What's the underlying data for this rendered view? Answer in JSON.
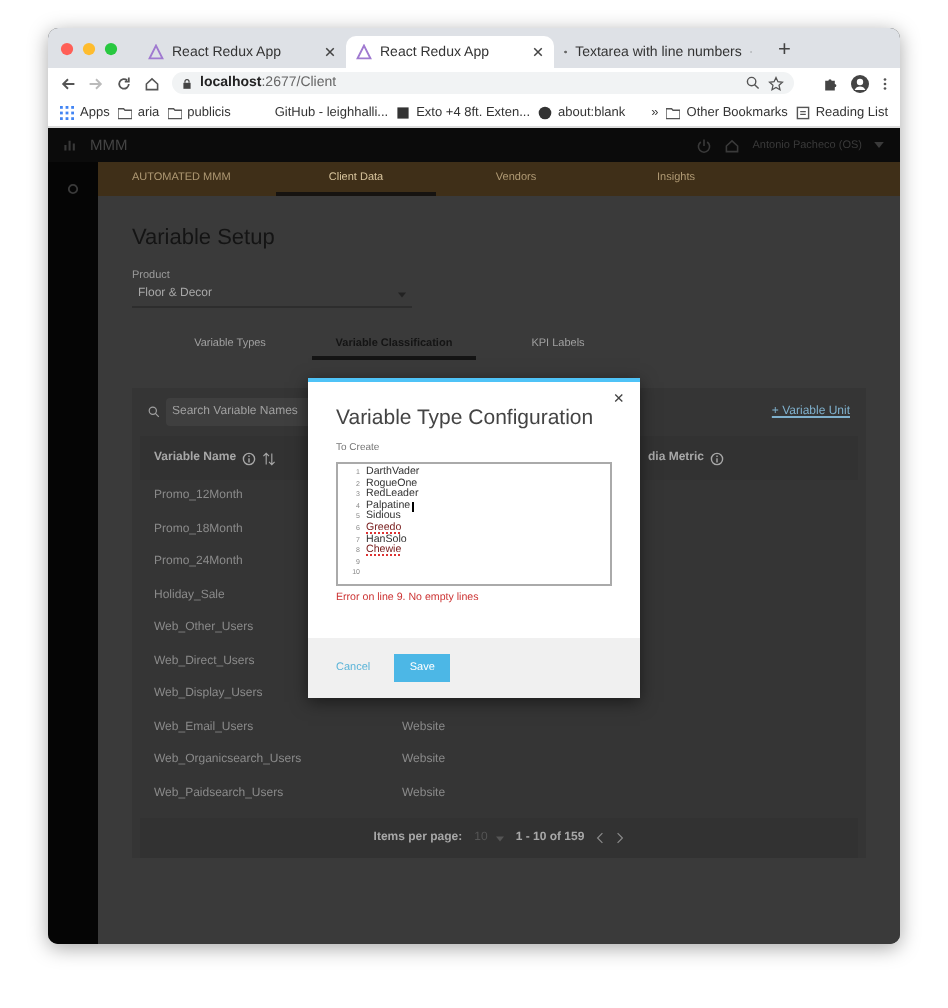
{
  "browser": {
    "tabs": [
      {
        "title": "React Redux App",
        "selected": false
      },
      {
        "title": "React Redux App",
        "selected": true
      },
      {
        "title": "Textarea with line numbers",
        "selected": false
      }
    ],
    "new_tab": "+",
    "url_host": "localhost",
    "url_path": ":2677/Client",
    "bookmarks": [
      "Apps",
      "aria",
      "publicis",
      "GitHub - leighhalli...",
      "Exto +4 8ft. Exten...",
      "about:blank"
    ],
    "more": "»",
    "other_bookmarks": "Other Bookmarks",
    "reading_list": "Reading List"
  },
  "app": {
    "logo": "MMM",
    "user": "Antonio Pacheco (OS)",
    "nav": [
      {
        "label": "AUTOMATED MMM",
        "selected": false
      },
      {
        "label": "Client Data",
        "selected": true
      },
      {
        "label": "Vendors",
        "selected": false
      },
      {
        "label": "Insights",
        "selected": false
      }
    ],
    "title": "Variable Setup",
    "product_label": "Product",
    "product_value": "Floor & Decor",
    "tabs": [
      {
        "label": "Variable Types",
        "selected": false
      },
      {
        "label": "Variable Classification",
        "selected": true
      },
      {
        "label": "KPI Labels",
        "selected": false
      }
    ],
    "search": {
      "placeholder": "Search Variable Names"
    },
    "add_link": "+ Variable Unit",
    "columns": [
      "Variable Name",
      "dia Metric"
    ],
    "rows": [
      {
        "name": "Promo_12Month"
      },
      {
        "name": "Promo_18Month"
      },
      {
        "name": "Promo_24Month"
      },
      {
        "name": "Holiday_Sale"
      },
      {
        "name": "Web_Other_Users"
      },
      {
        "name": "Web_Direct_Users"
      },
      {
        "name": "Web_Display_Users"
      },
      {
        "name": "Web_Email_Users",
        "metric": "Website"
      },
      {
        "name": "Web_Organicsearch_Users",
        "metric": "Website"
      },
      {
        "name": "Web_Paidsearch_Users",
        "metric": "Website"
      }
    ],
    "pagination": {
      "label": "Items per page:",
      "size": "10",
      "range": "1 - 10 of 159"
    }
  },
  "modal": {
    "title": "Variable Type Configuration",
    "close": "×",
    "label": "To Create",
    "lines": [
      {
        "number": "1",
        "text": "DarthVader",
        "misspelled": false,
        "cursor": false
      },
      {
        "number": "2",
        "text": "RogueOne",
        "misspelled": false,
        "cursor": false
      },
      {
        "number": "3",
        "text": "RedLeader",
        "misspelled": false,
        "cursor": false
      },
      {
        "number": "4",
        "text": "Palpatine",
        "misspelled": false,
        "cursor": true
      },
      {
        "number": "5",
        "text": "Sidious",
        "misspelled": false,
        "cursor": false
      },
      {
        "number": "6",
        "text": "Greedo",
        "misspelled": true,
        "cursor": false
      },
      {
        "number": "7",
        "text": "HanSolo",
        "misspelled": false,
        "cursor": false
      },
      {
        "number": "8",
        "text": "Chewie",
        "misspelled": true,
        "cursor": false
      },
      {
        "number": "9",
        "cursor": false
      },
      {
        "number": "10",
        "cursor": false
      }
    ],
    "error": "Error on line 9. No empty lines",
    "cancel": "Cancel",
    "save": "Save"
  }
}
